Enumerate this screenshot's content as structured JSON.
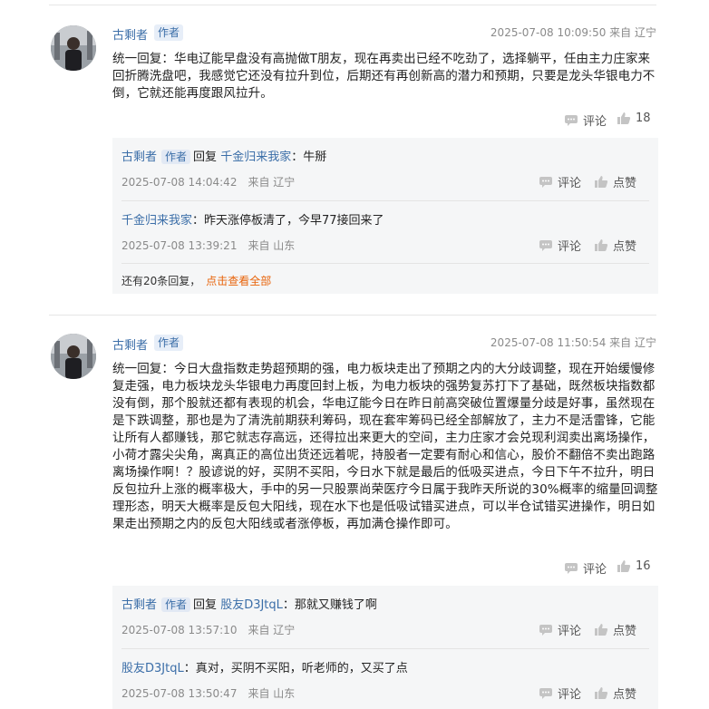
{
  "posts": [
    {
      "author": "古剩者",
      "badge": "作者",
      "time_loc": "2025-07-08 10:09:50 来自 辽宁",
      "content": "统一回复：华电辽能早盘没有高抛做T朋友，现在再卖出已经不吃劲了，选择躺平，任由主力庄家来回折腾洗盘吧，我感觉它还没有拉升到位，后期还有再创新高的潜力和预期，只要是龙头华银电力不倒，它就还能再度跟风拉升。",
      "comment_label": "评论",
      "like_count": "18",
      "replies": [
        {
          "user": "古剩者",
          "badge": "作者",
          "reply_word": "回复",
          "target": "千金归来我家",
          "text": "：牛掰",
          "time": "2025-07-08 14:04:42",
          "loc": "来自 辽宁",
          "comment_label": "评论",
          "like_label": "点赞"
        },
        {
          "user": "千金归来我家",
          "text": "：昨天涨停板清了，今早77接回来了",
          "time": "2025-07-08 13:39:21",
          "loc": "来自 山东",
          "comment_label": "评论",
          "like_label": "点赞"
        }
      ],
      "more_text": "还有20条回复，",
      "more_link": "点击查看全部"
    },
    {
      "author": "古剩者",
      "badge": "作者",
      "time_loc": "2025-07-08 11:50:54 来自 辽宁",
      "content": "统一回复：今日大盘指数走势超预期的强，电力板块走出了预期之内的大分歧调整，现在开始缓慢修复走强，电力板块龙头华银电力再度回封上板，为电力板块的强势复苏打下了基础，既然板块指数都没有倒，那个股就还都有表现的机会，华电辽能今日在昨日前高突破位置爆量分歧是好事，虽然现在是下跌调整，那也是为了清洗前期获利筹码，现在套牢筹码已经全部解放了，主力不是活雷锋，它能让所有人都赚钱，那它就志存高远，还得拉出来更大的空间，主力庄家才会兑现利润卖出离场操作，小荷才露尖尖角，离真正的高位出货还远着呢，持股者一定要有耐心和信心，股价不翻倍不卖出跑路离场操作啊！？股谚说的好，买阴不买阳，今日水下就是最后的低吸买进点，今日下午不拉升，明日反包拉升上涨的概率极大，手中的另一只股票尚荣医疗今日属于我昨天所说的30%概率的缩量回调整理形态，明天大概率是反包大阳线，现在水下也是低吸试错买进点，可以半仓试错买进操作，明日如果走出预期之内的反包大阳线或者涨停板，再加满仓操作即可。",
      "comment_label": "评论",
      "like_count": "16",
      "replies": [
        {
          "user": "古剩者",
          "badge": "作者",
          "reply_word": "回复",
          "target": "股友D3JtqL",
          "text": "：那就又赚钱了啊",
          "time": "2025-07-08 13:57:10",
          "loc": "来自 辽宁",
          "comment_label": "评论",
          "like_label": "点赞"
        },
        {
          "user": "股友D3JtqL",
          "text": "：真对，买阴不买阳，听老师的，又买了点",
          "time": "2025-07-08 13:50:47",
          "loc": "来自 山东",
          "comment_label": "评论",
          "like_label": "点赞"
        }
      ]
    }
  ],
  "colors": {
    "link": "#3b6ea8",
    "orange": "#e8630a",
    "meta": "#8a8a8a"
  },
  "icons": {
    "comment": "comment-icon",
    "like": "thumbs-up-icon"
  }
}
